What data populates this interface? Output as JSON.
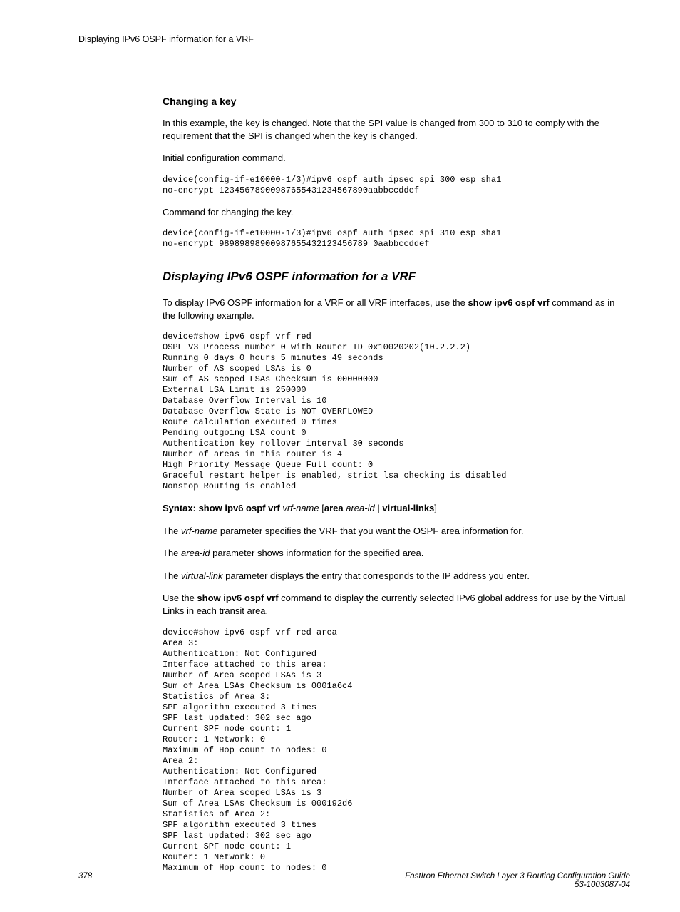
{
  "header": {
    "running": "Displaying IPv6 OSPF information for a VRF"
  },
  "sec1": {
    "h": "Changing a key",
    "p1": "In this example, the key is changed. Note that the SPI value is changed from 300 to 310 to comply with the requirement that the SPI is changed when the key is changed.",
    "p2": "Initial configuration command.",
    "code1": "device(config-if-e10000-1/3)#ipv6 ospf auth ipsec spi 300 esp sha1\nno-encrypt 12345678900987655431234567890aabbccddef",
    "p3": "Command for changing the key.",
    "code2": "device(config-if-e10000-1/3)#ipv6 ospf auth ipsec spi 310 esp sha1\nno-encrypt 98989898900987655432123456789 0aabbccddef"
  },
  "sec2": {
    "h": "Displaying IPv6 OSPF information for a VRF",
    "p1a": "To display IPv6 OSPF information for a VRF or all VRF interfaces, use the ",
    "p1b": "show ipv6 ospf vrf",
    "p1c": " command as in the following example.",
    "code1": "device#show ipv6 ospf vrf red\nOSPF V3 Process number 0 with Router ID 0x10020202(10.2.2.2)\nRunning 0 days 0 hours 5 minutes 49 seconds\nNumber of AS scoped LSAs is 0\nSum of AS scoped LSAs Checksum is 00000000\nExternal LSA Limit is 250000\nDatabase Overflow Interval is 10\nDatabase Overflow State is NOT OVERFLOWED\nRoute calculation executed 0 times\nPending outgoing LSA count 0\nAuthentication key rollover interval 30 seconds\nNumber of areas in this router is 4\nHigh Priority Message Queue Full count: 0\nGraceful restart helper is enabled, strict lsa checking is disabled\nNonstop Routing is enabled",
    "syntax": {
      "lead": "Syntax: show ipv6 ospf vrf ",
      "vrf": "vrf-name",
      "lb": " [",
      "area": "area",
      "sp": " ",
      "areaid": "area-id",
      "pipe": " | ",
      "vl": "virtual-links",
      "rb": "]"
    },
    "p2a": "The ",
    "p2b": "vrf-name",
    "p2c": " parameter specifies the VRF that you want the OSPF area information for.",
    "p3a": "The ",
    "p3b": "area-id",
    "p3c": " parameter shows information for the specified area.",
    "p4a": "The ",
    "p4b": "virtual-link",
    "p4c": " parameter displays the entry that corresponds to the IP address you enter.",
    "p5a": "Use the ",
    "p5b": "show ipv6 ospf vrf",
    "p5c": " command to display the currently selected IPv6 global address for use by the Virtual Links in each transit area.",
    "code2": "device#show ipv6 ospf vrf red area\nArea 3:\nAuthentication: Not Configured\nInterface attached to this area:\nNumber of Area scoped LSAs is 3\nSum of Area LSAs Checksum is 0001a6c4\nStatistics of Area 3:\nSPF algorithm executed 3 times\nSPF last updated: 302 sec ago\nCurrent SPF node count: 1\nRouter: 1 Network: 0\nMaximum of Hop count to nodes: 0\nArea 2:\nAuthentication: Not Configured\nInterface attached to this area:\nNumber of Area scoped LSAs is 3\nSum of Area LSAs Checksum is 000192d6\nStatistics of Area 2:\nSPF algorithm executed 3 times\nSPF last updated: 302 sec ago\nCurrent SPF node count: 1\nRouter: 1 Network: 0\nMaximum of Hop count to nodes: 0"
  },
  "footer": {
    "page": "378",
    "title": "FastIron Ethernet Switch Layer 3 Routing Configuration Guide",
    "docnum": "53-1003087-04"
  }
}
